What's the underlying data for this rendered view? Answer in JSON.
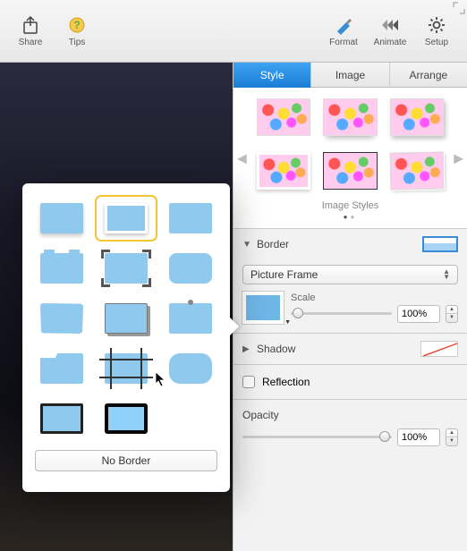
{
  "toolbar": {
    "share": "Share",
    "tips": "Tips",
    "format": "Format",
    "animate": "Animate",
    "setup": "Setup"
  },
  "tabs": {
    "style": "Style",
    "image": "Image",
    "arrange": "Arrange"
  },
  "image_styles_label": "Image Styles",
  "border": {
    "title": "Border",
    "type_label": "Picture Frame",
    "scale_label": "Scale",
    "scale_value": "100%"
  },
  "shadow": {
    "title": "Shadow"
  },
  "reflection": {
    "title": "Reflection"
  },
  "opacity": {
    "title": "Opacity",
    "value": "100%"
  },
  "popover": {
    "no_border": "No Border"
  }
}
